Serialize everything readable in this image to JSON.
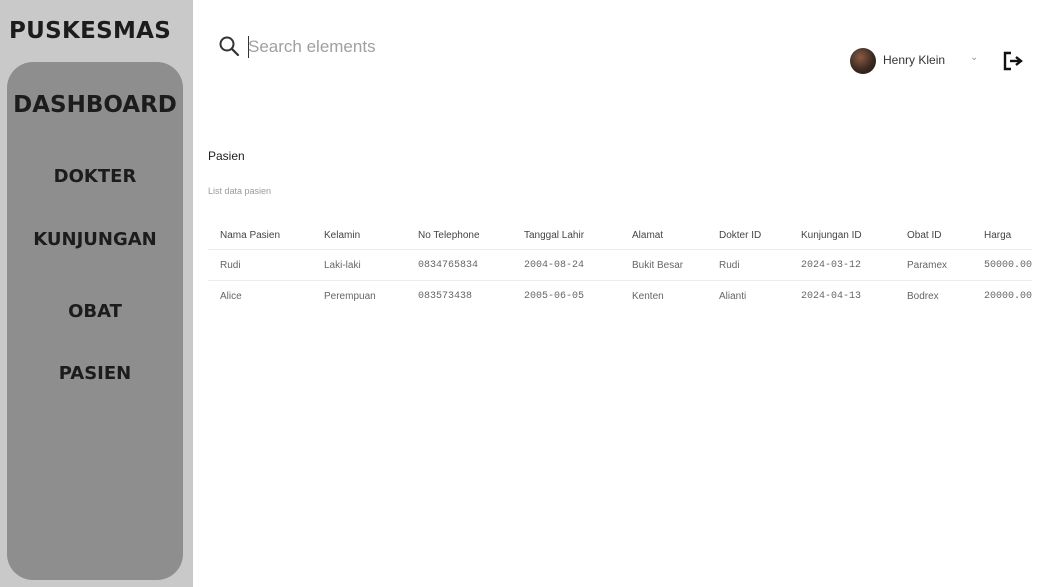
{
  "sidebar": {
    "brand": "PUSKESMAS",
    "items": [
      {
        "label": "DASHBOARD"
      },
      {
        "label": "DOKTER"
      },
      {
        "label": "KUNJUNGAN"
      },
      {
        "label": "OBAT"
      },
      {
        "label": "PASIEN"
      }
    ]
  },
  "header": {
    "search": {
      "placeholder": "Search elements",
      "value": "",
      "icon": "search-icon"
    },
    "user": {
      "name": "Henry Klein",
      "chevron": "⌄"
    },
    "logout_icon": "logout-icon"
  },
  "main": {
    "title": "Pasien",
    "subtitle": "List data pasien",
    "table": {
      "columns": [
        "Nama Pasien",
        "Kelamin",
        "No Telephone",
        "Tanggal Lahir",
        "Alamat",
        "Dokter ID",
        "Kunjungan ID",
        "Obat ID",
        "Harga"
      ],
      "rows": [
        [
          "Rudi",
          "Laki-laki",
          "0834765834",
          "2004-08-24",
          "Bukit Besar",
          "Rudi",
          "2024-03-12",
          "Paramex",
          "50000.00"
        ],
        [
          "Alice",
          "Perempuan",
          "083573438",
          "2005-06-05",
          "Kenten",
          "Alianti",
          "2024-04-13",
          "Bodrex",
          "20000.00"
        ]
      ]
    }
  }
}
